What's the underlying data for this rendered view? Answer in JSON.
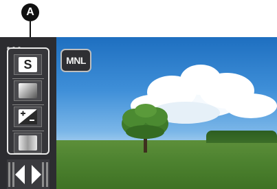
{
  "callout": {
    "label": "A"
  },
  "side_menu": {
    "items": [
      {
        "id": "scene-mode",
        "icon": "scene-s-icon",
        "label": "S"
      },
      {
        "id": "shutter",
        "icon": "gradient-icon"
      },
      {
        "id": "exposure",
        "icon": "exposure-compensation-icon"
      },
      {
        "id": "white-balance",
        "icon": "white-balance-icon"
      }
    ],
    "nav": {
      "prev_icon": "triangle-left-icon",
      "next_icon": "triangle-right-icon"
    }
  },
  "mode_button": {
    "label": "MNL"
  }
}
